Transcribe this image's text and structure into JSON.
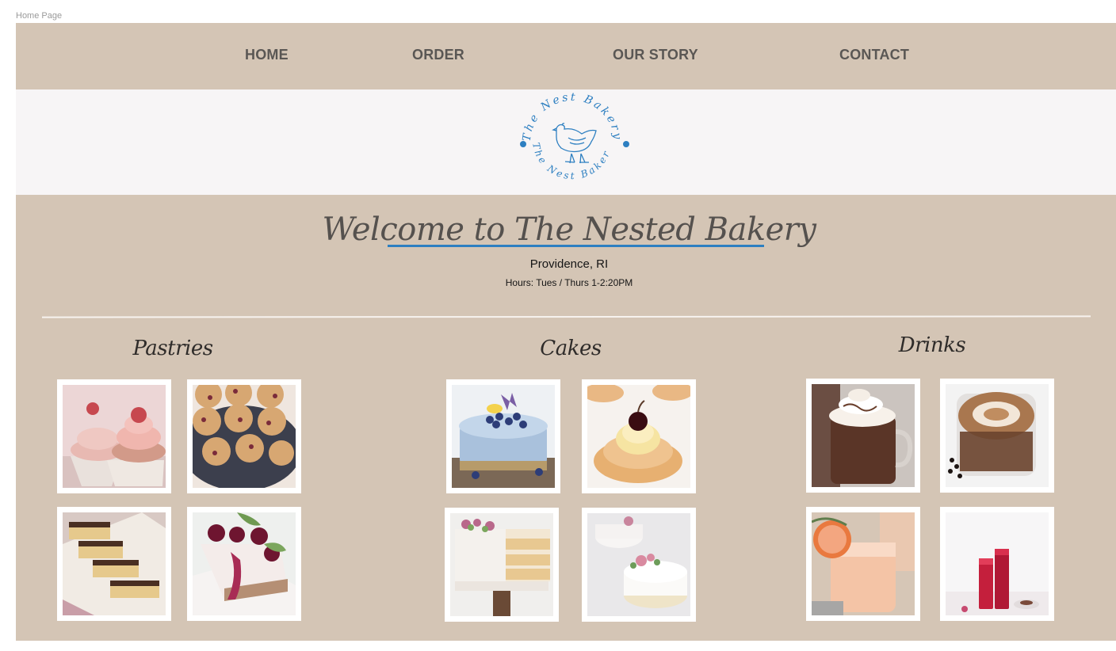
{
  "frame_label": "Home Page",
  "nav": {
    "items": [
      "HOME",
      "ORDER",
      "OUR STORY",
      "CONTACT"
    ]
  },
  "logo": {
    "text_top": "The Nest Bakery",
    "text_bottom": "The Nest Bakery",
    "color": "#2d7fc1"
  },
  "hero": {
    "title": "Welcome to The Nested Bakery",
    "location": "Providence, RI",
    "hours": "Hours: Tues / Thurs 1-2:20PM"
  },
  "categories": [
    {
      "title": "Pastries",
      "images": [
        "raspberry cupcakes",
        "blueberry muffins",
        "chocolate napoleon pastries",
        "cherry cheesecake slice"
      ]
    },
    {
      "title": "Cakes",
      "images": [
        "blueberry lemon cake",
        "cream puff with cherry",
        "naked layer cake",
        "floral white cakes"
      ]
    },
    {
      "title": "Drinks",
      "images": [
        "hot chocolate with cream",
        "latte",
        "grapefruit cocktail",
        "red berry drinks"
      ]
    }
  ],
  "colors": {
    "page_background": "#d4c5b5",
    "logo_band": "#f7f5f6",
    "nav_text": "#5a5754",
    "accent_underline": "#2d7fc1"
  }
}
